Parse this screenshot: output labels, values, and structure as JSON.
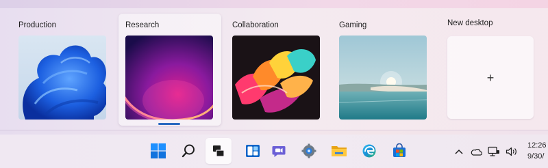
{
  "task_view": {
    "desktops": [
      {
        "label": "Production",
        "wallpaper": "blue-bloom",
        "active": false
      },
      {
        "label": "Research",
        "wallpaper": "purple-glow",
        "active": true
      },
      {
        "label": "Collaboration",
        "wallpaper": "colorful-ribbons",
        "active": false
      },
      {
        "label": "Gaming",
        "wallpaper": "lake-sunrise",
        "active": false
      }
    ],
    "new_desktop": {
      "label": "New desktop",
      "plus": "+"
    }
  },
  "taskbar": {
    "apps": [
      {
        "name": "start-button",
        "icon": "windows-logo-icon"
      },
      {
        "name": "search-button",
        "icon": "magnifier-icon"
      },
      {
        "name": "task-view-button",
        "icon": "task-view-icon",
        "pressed": true
      },
      {
        "name": "widgets-button",
        "icon": "widgets-icon"
      },
      {
        "name": "chat-button",
        "icon": "teams-chat-icon"
      },
      {
        "name": "settings-button",
        "icon": "gear-icon"
      },
      {
        "name": "file-explorer-button",
        "icon": "folder-icon"
      },
      {
        "name": "edge-button",
        "icon": "edge-icon"
      },
      {
        "name": "store-button",
        "icon": "store-icon"
      }
    ],
    "tray": {
      "icons": [
        "chevron-up-icon",
        "onedrive-icon",
        "network-icon",
        "volume-icon"
      ],
      "time": "12:26",
      "date": "9/30/"
    },
    "accent": "#0067c0"
  }
}
